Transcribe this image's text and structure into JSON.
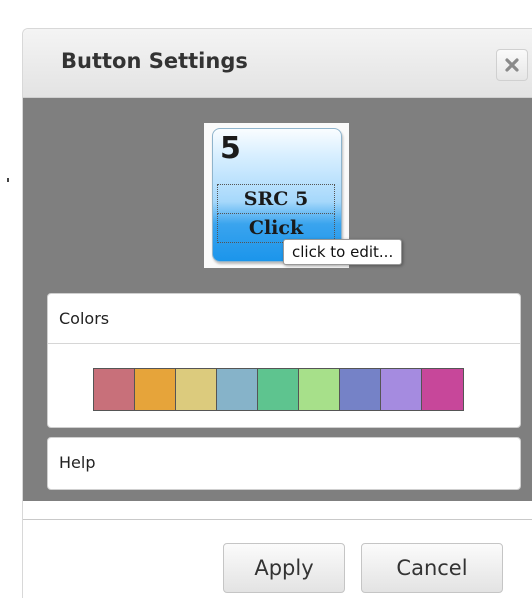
{
  "dialog": {
    "title": "Button Settings",
    "close_icon": "close-x-icon"
  },
  "preview": {
    "number": "5",
    "line1": "SRC 5",
    "line2": "Click",
    "tooltip": "click to edit...",
    "gradient_top": "#d8efff",
    "gradient_bottom": "#1b95eb"
  },
  "colors_panel": {
    "label": "Colors",
    "swatches": [
      "#c8707a",
      "#e6a43a",
      "#dccb7d",
      "#86b3c9",
      "#5ec48f",
      "#a7e08a",
      "#7582c7",
      "#a58be0",
      "#c7479a"
    ]
  },
  "help_panel": {
    "label": "Help"
  },
  "footer": {
    "apply_label": "Apply",
    "cancel_label": "Cancel"
  }
}
